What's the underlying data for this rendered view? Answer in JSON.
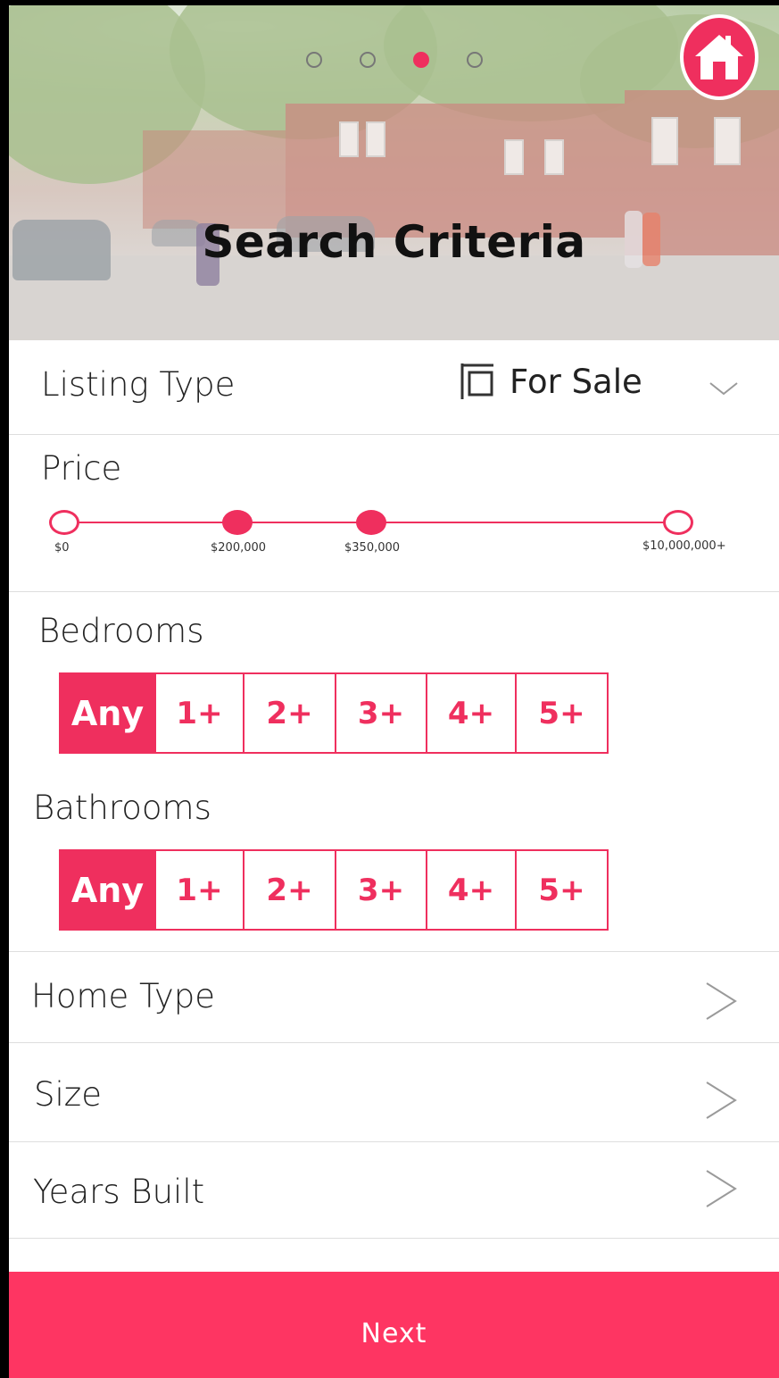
{
  "header": {
    "title": "Search Criteria",
    "steps": [
      {
        "active": false
      },
      {
        "active": false
      },
      {
        "active": true
      },
      {
        "active": false
      }
    ],
    "home_icon": "home-icon",
    "accent_color": "#ef2f5e"
  },
  "listing_type": {
    "label": "Listing Type",
    "value": "For Sale",
    "icon": "sign-icon",
    "chevron": "chevron-down-icon"
  },
  "price": {
    "label": "Price",
    "ticks": [
      "$0",
      "$200,000",
      "$350,000",
      "$10,000,000+"
    ],
    "selected_min": "$200,000",
    "selected_max": "$350,000"
  },
  "bedrooms": {
    "label": "Bedrooms",
    "options": [
      "Any",
      "1+",
      "2+",
      "3+",
      "4+",
      "5+"
    ],
    "selected": "Any"
  },
  "bathrooms": {
    "label": "Bathrooms",
    "options": [
      "Any",
      "1+",
      "2+",
      "3+",
      "4+",
      "5+"
    ],
    "selected": "Any"
  },
  "home_type": {
    "label": "Home Type",
    "chevron": "chevron-right-icon"
  },
  "size": {
    "label": "Size",
    "chevron": "chevron-right-icon"
  },
  "years_built": {
    "label": "Years Built",
    "chevron": "chevron-right-icon"
  },
  "next_button": {
    "label": "Next",
    "color": "#fe3562"
  }
}
